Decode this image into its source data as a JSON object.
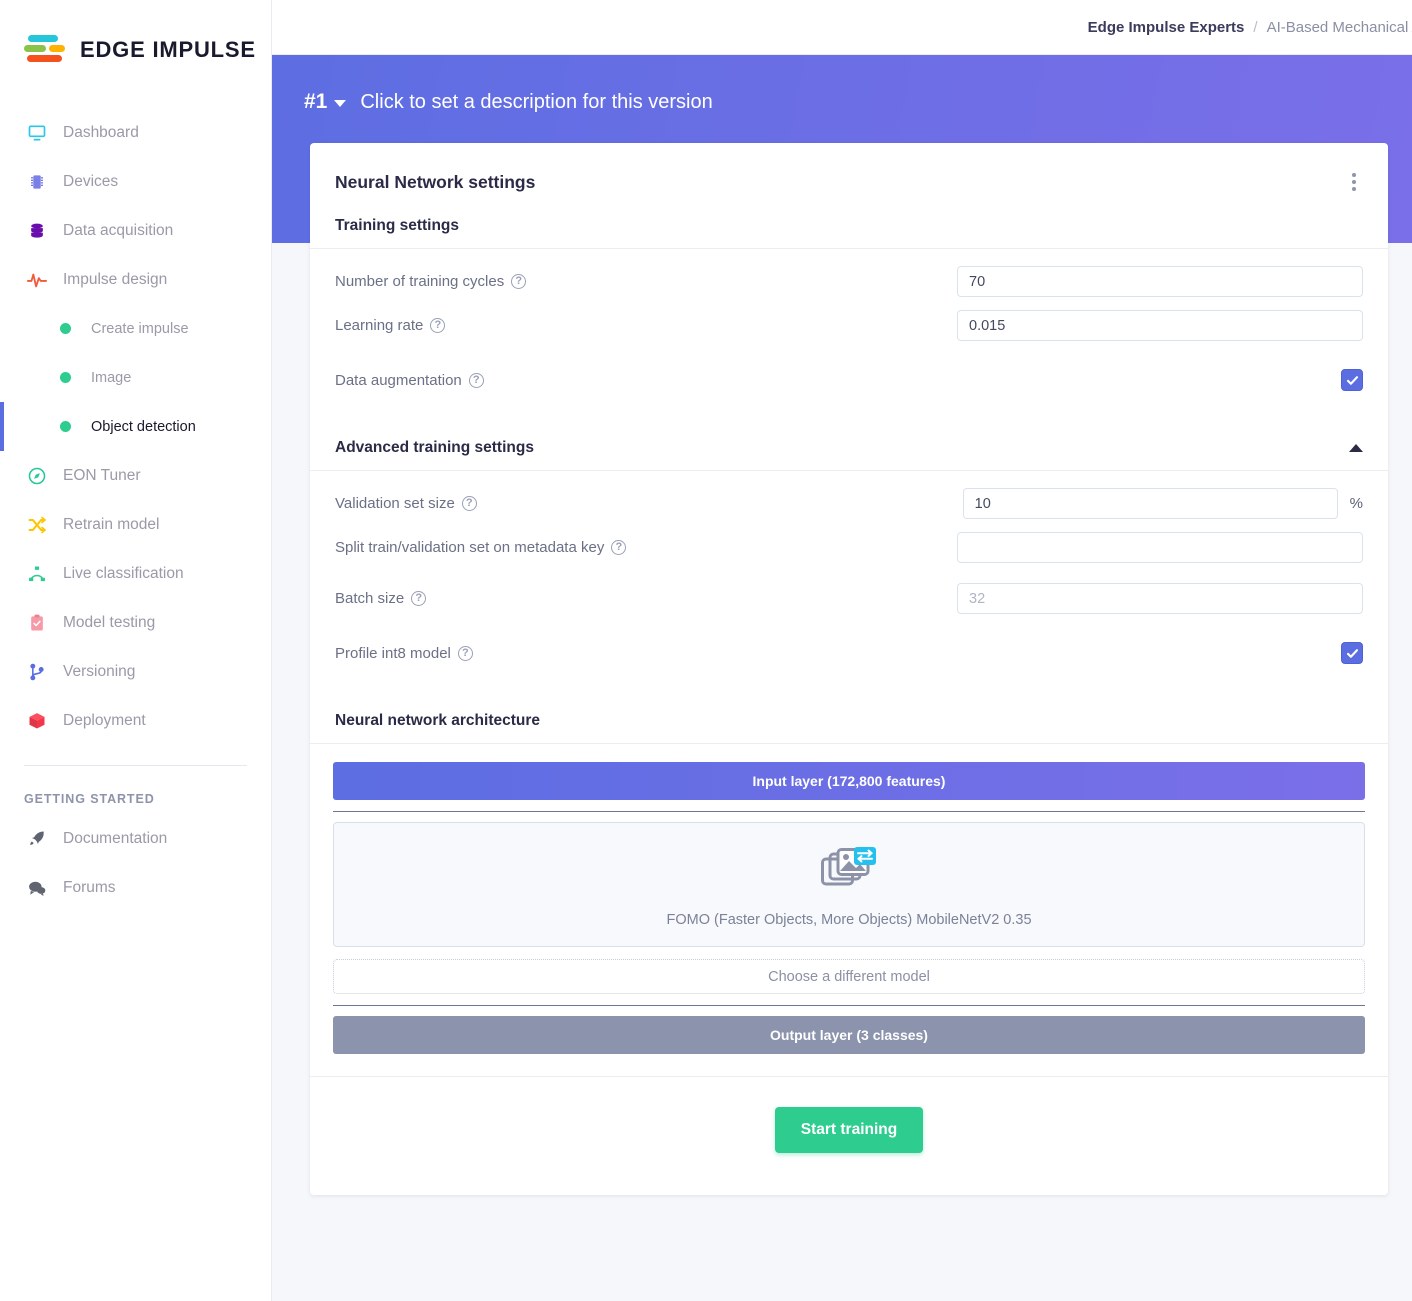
{
  "brand": {
    "name": "EDGE IMPULSE"
  },
  "breadcrumb": {
    "org": "Edge Impulse Experts",
    "separator": "/",
    "project": "AI-Based Mechanical An"
  },
  "sidebar": {
    "items": [
      {
        "label": "Dashboard",
        "icon": "monitor-icon",
        "name": "dashboard"
      },
      {
        "label": "Devices",
        "icon": "chip-icon",
        "name": "devices"
      },
      {
        "label": "Data acquisition",
        "icon": "database-icon",
        "name": "data-acquisition"
      },
      {
        "label": "Impulse design",
        "icon": "pulse-icon",
        "name": "impulse-design"
      }
    ],
    "sub_items": [
      {
        "label": "Create impulse",
        "name": "create-impulse",
        "selected": false
      },
      {
        "label": "Image",
        "name": "image",
        "selected": false
      },
      {
        "label": "Object detection",
        "name": "object-detection",
        "selected": true
      }
    ],
    "items_after": [
      {
        "label": "EON Tuner",
        "icon": "compass-icon",
        "name": "eon-tuner"
      },
      {
        "label": "Retrain model",
        "icon": "shuffle-icon",
        "name": "retrain-model"
      },
      {
        "label": "Live classification",
        "icon": "nodes-icon",
        "name": "live-classification"
      },
      {
        "label": "Model testing",
        "icon": "clipboard-check-icon",
        "name": "model-testing"
      },
      {
        "label": "Versioning",
        "icon": "branch-icon",
        "name": "versioning"
      },
      {
        "label": "Deployment",
        "icon": "cube-icon",
        "name": "deployment"
      }
    ],
    "section_title": "GETTING STARTED",
    "footer_items": [
      {
        "label": "Documentation",
        "icon": "rocket-icon",
        "name": "documentation"
      },
      {
        "label": "Forums",
        "icon": "chat-icon",
        "name": "forums"
      }
    ]
  },
  "version": {
    "number": "#1",
    "description": "Click to set a description for this version"
  },
  "card": {
    "title": "Neural Network settings",
    "menu_icon": "kebab-menu-icon"
  },
  "training": {
    "heading": "Training settings",
    "cycles_label": "Number of training cycles",
    "cycles_value": "70",
    "learning_rate_label": "Learning rate",
    "learning_rate_value": "0.015",
    "augmentation_label": "Data augmentation",
    "augmentation_checked": true
  },
  "advanced": {
    "heading": "Advanced training settings",
    "expanded": true,
    "validation_label": "Validation set size",
    "validation_value": "10",
    "validation_unit": "%",
    "split_label": "Split train/validation set on metadata key",
    "split_value": "",
    "split_placeholder": "",
    "batch_label": "Batch size",
    "batch_value": "",
    "batch_placeholder": "32",
    "profile_label": "Profile int8 model",
    "profile_checked": true
  },
  "architecture": {
    "heading": "Neural network architecture",
    "input_layer": "Input layer (172,800 features)",
    "model_name": "FOMO (Faster Objects, More Objects) MobileNetV2 0.35",
    "model_icon": "image-transfer-icon",
    "choose_model": "Choose a different model",
    "output_layer": "Output layer (3 classes)"
  },
  "actions": {
    "start_training": "Start training"
  },
  "colors": {
    "accent_purple": "#5b6ee1",
    "success_green": "#2ecc8f",
    "output_gray": "#8b93ad",
    "band_gradient_start": "#5d6ee2",
    "band_gradient_end": "#7a6fe8"
  }
}
